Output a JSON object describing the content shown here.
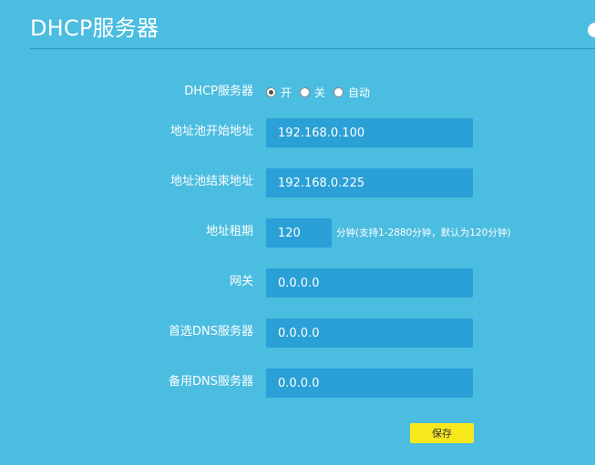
{
  "header": {
    "title": "DHCP服务器"
  },
  "form": {
    "dhcp_server": {
      "label": "DHCP服务器",
      "options": [
        {
          "label": "开",
          "checked": true
        },
        {
          "label": "关",
          "checked": false
        },
        {
          "label": "自动",
          "checked": false
        }
      ]
    },
    "pool_start": {
      "label": "地址池开始地址",
      "value": "192.168.0.100"
    },
    "pool_end": {
      "label": "地址池结束地址",
      "value": "192.168.0.225"
    },
    "lease_time": {
      "label": "地址租期",
      "value": "120",
      "hint": "分钟(支持1-2880分钟，默认为120分钟)"
    },
    "gateway": {
      "label": "网关",
      "value": "0.0.0.0"
    },
    "primary_dns": {
      "label": "首选DNS服务器",
      "value": "0.0.0.0"
    },
    "secondary_dns": {
      "label": "备用DNS服务器",
      "value": "0.0.0.0"
    },
    "save_label": "保存"
  },
  "colors": {
    "background": "#4bbde0",
    "field_background": "#2aa0d6",
    "save_button": "#f7e81e",
    "text": "#ffffff"
  }
}
